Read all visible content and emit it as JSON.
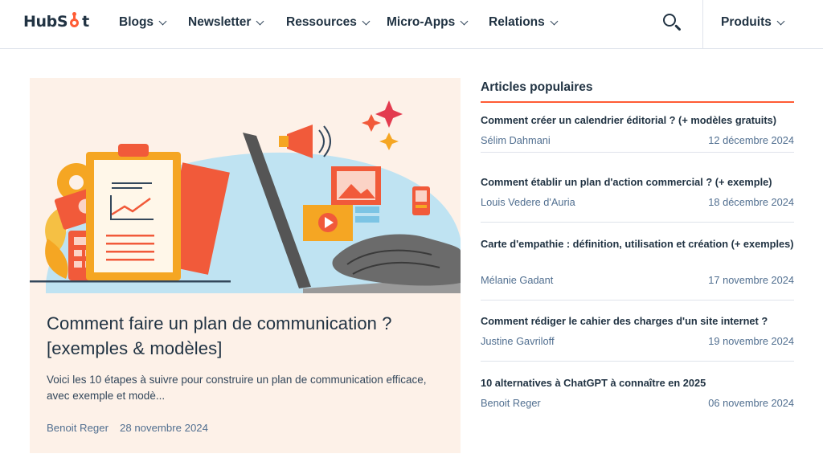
{
  "brand": {
    "logo_text_left": "HubS",
    "logo_text_right": "t",
    "accent": "#ff5c35"
  },
  "nav": {
    "items": [
      {
        "label": "Blogs"
      },
      {
        "label": "Newsletter"
      },
      {
        "label": "Ressources"
      },
      {
        "label": "Micro-Apps"
      },
      {
        "label": "Relations"
      }
    ],
    "products_label": "Produits"
  },
  "featured": {
    "title": "Comment faire un plan de communication ? [exemples & modèles]",
    "excerpt": "Voici les 10 étapes à suivre pour construire un plan de communication efficace, avec exemple et modè...",
    "author": "Benoit Reger",
    "date": "28 novembre 2024"
  },
  "popular": {
    "heading": "Articles populaires",
    "items": [
      {
        "title": "Comment créer un calendrier éditorial ? (+ modèles gratuits)",
        "author": "Sélim Dahmani",
        "date": "12 décembre 2024"
      },
      {
        "title": "Comment établir un plan d'action commercial ? (+ exemple)",
        "author": "Louis Vedere d'Auria",
        "date": "18 décembre 2024"
      },
      {
        "title": "Carte d'empathie : définition, utilisation et création (+ exemples)",
        "author": "Mélanie Gadant",
        "date": "17 novembre 2024"
      },
      {
        "title": "Comment rédiger le cahier des charges d'un site internet ?",
        "author": "Justine Gavriloff",
        "date": "19 novembre 2024"
      },
      {
        "title": "10 alternatives à ChatGPT à connaître en 2025",
        "author": "Benoit Reger",
        "date": "06 novembre 2024"
      }
    ]
  }
}
